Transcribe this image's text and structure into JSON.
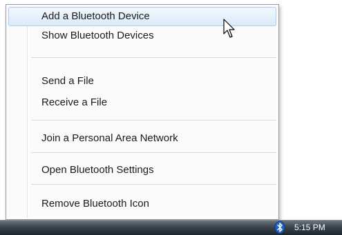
{
  "menu": {
    "items": [
      {
        "label": "Add a Bluetooth Device"
      },
      {
        "label": "Show Bluetooth Devices"
      },
      {
        "label": "Send a File"
      },
      {
        "label": "Receive a File"
      },
      {
        "label": "Join a Personal Area Network"
      },
      {
        "label": "Open Bluetooth Settings"
      },
      {
        "label": "Remove Bluetooth Icon"
      }
    ]
  },
  "taskbar": {
    "tray_icon": "bluetooth-icon",
    "clock": "5:15 PM"
  },
  "colors": {
    "highlight": "#dbeaf9",
    "highlight_border": "#a8cdf1",
    "taskbar": "#2b333a"
  }
}
